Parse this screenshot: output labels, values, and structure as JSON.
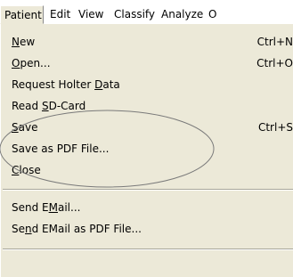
{
  "menubar": {
    "items": [
      {
        "label": "Patient"
      },
      {
        "label": "Edit"
      },
      {
        "label": "View"
      },
      {
        "label": "Classify"
      },
      {
        "label": "Analyze"
      },
      {
        "label": "O"
      }
    ]
  },
  "menu": {
    "items": [
      {
        "pre": "",
        "key": "N",
        "post": "ew",
        "shortcut": "Ctrl+N"
      },
      {
        "pre": "",
        "key": "O",
        "post": "pen...",
        "shortcut": "Ctrl+O"
      },
      {
        "pre": "Request Holter ",
        "key": "D",
        "post": "ata",
        "shortcut": ""
      },
      {
        "pre": "Read ",
        "key": "S",
        "post": "D-Card",
        "shortcut": ""
      },
      {
        "pre": "",
        "key": "S",
        "post": "ave",
        "shortcut": "Ctrl+S"
      },
      {
        "pre": "Save as PDF File...",
        "key": "",
        "post": "",
        "shortcut": ""
      },
      {
        "pre": "",
        "key": "C",
        "post": "lose",
        "shortcut": ""
      },
      {
        "pre": "Send E",
        "key": "M",
        "post": "ail...",
        "shortcut": ""
      },
      {
        "pre": "Se",
        "key": "n",
        "post": "d EMail as PDF File...",
        "shortcut": ""
      }
    ]
  },
  "colors": {
    "menu_background": "#ece9d8",
    "annotation_stroke": "#7a7a7a"
  }
}
